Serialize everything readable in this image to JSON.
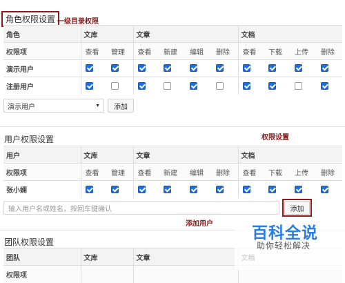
{
  "role_section": {
    "title": "角色权限设置",
    "annotation": "一级目录权限",
    "groups": [
      "文库",
      "文章",
      "文档"
    ],
    "head_label": "角色",
    "item_label": "权限项",
    "permissions": [
      "查看",
      "管理",
      "查看",
      "新建",
      "编辑",
      "删除",
      "查看",
      "下载",
      "上传",
      "删除"
    ],
    "rows": [
      {
        "name": "演示用户",
        "checks": [
          true,
          true,
          true,
          true,
          true,
          true,
          true,
          true,
          true,
          true
        ]
      },
      {
        "name": "注册用户",
        "checks": [
          true,
          false,
          true,
          false,
          true,
          false,
          true,
          true,
          false,
          true
        ]
      }
    ],
    "select_value": "演示用户",
    "add_button": "添加"
  },
  "user_section": {
    "title": "用户权限设置",
    "annotation": "权限设置",
    "groups": [
      "文库",
      "文章",
      "文档"
    ],
    "head_label": "用户",
    "item_label": "权限项",
    "permissions": [
      "查看",
      "管理",
      "查看",
      "新建",
      "编辑",
      "删除",
      "查看",
      "下载",
      "上传",
      "删除"
    ],
    "rows": [
      {
        "name": "张小娴",
        "checks": [
          true,
          true,
          true,
          true,
          true,
          true,
          true,
          true,
          true,
          true
        ]
      }
    ],
    "input_placeholder": "输入用户名或姓名，按回车键确认",
    "add_button": "添加",
    "add_annotation": "添加用户"
  },
  "team_section": {
    "title": "团队权限设置",
    "groups": [
      "文库",
      "文章",
      "文档"
    ],
    "head_label": "团队",
    "item_label": "权限项"
  },
  "watermark": {
    "title": "百科全说",
    "subtitle": "助你轻松解决"
  },
  "colors": {
    "check_blue": "#1e6fd9",
    "annotation_red": "#8b1a1a",
    "watermark_blue": "#2a7de1"
  }
}
